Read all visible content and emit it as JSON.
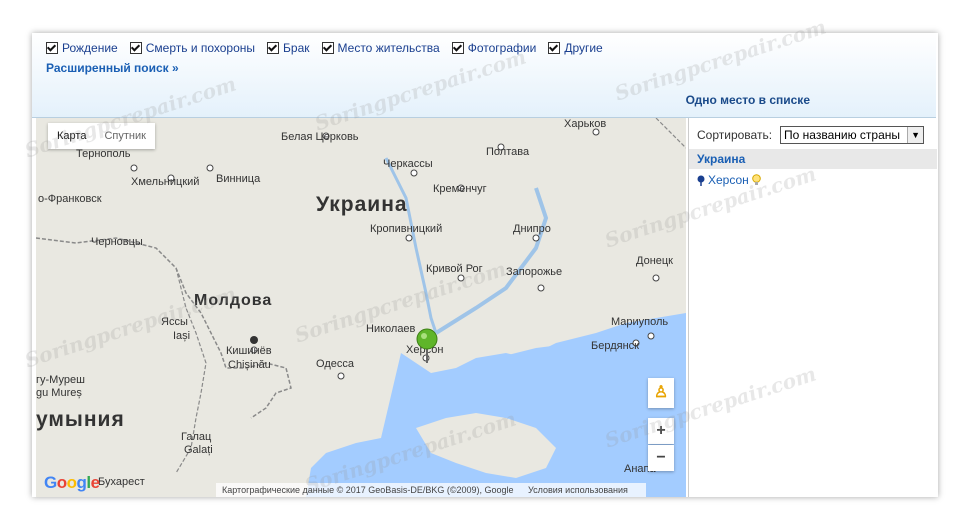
{
  "filters": [
    {
      "label": "Рождение",
      "checked": true
    },
    {
      "label": "Смерть и похороны",
      "checked": true
    },
    {
      "label": "Брак",
      "checked": true
    },
    {
      "label": "Место жительства",
      "checked": true
    },
    {
      "label": "Фотографии",
      "checked": true
    },
    {
      "label": "Другие",
      "checked": true
    }
  ],
  "advanced_search": "Расширенный поиск »",
  "places_count_text": "Одно место в списке",
  "map": {
    "type_buttons": [
      "Карта",
      "Спутник"
    ],
    "attribution": "Картографические данные © 2017 GeoBasis-DE/BKG (©2009), Google",
    "terms": "Условия использования",
    "logo": "Google",
    "zoom_in": "+",
    "zoom_out": "−",
    "labels": {
      "ukraine": "Украина",
      "moldova": "Молдова",
      "romania": "умыния",
      "kharkiv": "Харьков",
      "belaya_tserkov": "Белая Церковь",
      "ternopol": "Тернополь",
      "khmelnitsky": "Хмельницкий",
      "vinnitsa": "Винница",
      "frankovsk": "о-Франковск",
      "chernovtsy": "Черновцы",
      "cherkassy": "Черкассы",
      "poltava": "Полтава",
      "kremenchug": "Кременчуг",
      "kropyvnytsky": "Кропивницкий",
      "dnipro": "Днипро",
      "krivoy_rog": "Кривой Рог",
      "zaporozhye": "Запорожье",
      "donetsk": "Донецк",
      "yassy": "Яссы",
      "iasi": "Iași",
      "kishinev": "Кишинёв",
      "chisinau": "Chișinău",
      "nikolaev": "Николаев",
      "kherson": "Херсон",
      "odessa": "Одесса",
      "mariupol": "Мариуполь",
      "berdyansk": "Бердянск",
      "mures": "гу-Муреш",
      "mures_lat": "gu Mureș",
      "galats": "Галац",
      "galati": "Galați",
      "bukharest": "Бухарест",
      "anapa": "Анапа"
    }
  },
  "sidebar": {
    "sort_label": "Сортировать:",
    "sort_value": "По названию страны",
    "country": "Украина",
    "place": "Херсон"
  },
  "watermark": "Soringpcrepair.com",
  "colors": {
    "link": "#1a5fb4",
    "water": "#a3ccff",
    "land": "#e9e8e1",
    "marker": "#5fb52a"
  }
}
